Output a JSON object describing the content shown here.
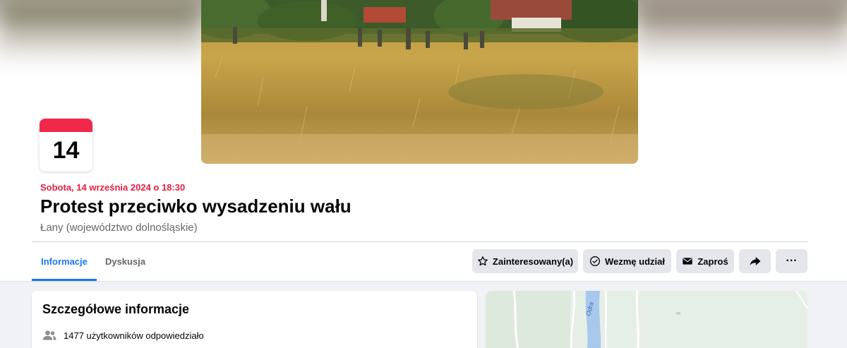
{
  "event": {
    "day_number": "14",
    "date_time": "Sobota, 14 września 2024 o 18:30",
    "title": "Protest przeciwko wysadzeniu wału",
    "location": "Łany (województwo dolnośląskie)"
  },
  "tabs": [
    {
      "label": "Informacje",
      "active": true
    },
    {
      "label": "Dyskusja",
      "active": false
    }
  ],
  "actions": {
    "interested_label": "Zainteresowany(a)",
    "interested_icon": "star-icon",
    "going_label": "Wezmę udział",
    "going_icon": "check-circle-icon",
    "invite_label": "Zaproś",
    "invite_icon": "envelope-icon",
    "share_icon": "share-arrow-icon",
    "more_label": "···"
  },
  "details": {
    "title": "Szczegółowe informacje",
    "responded": "1477 użytkowników odpowiedziało",
    "responded_icon": "people-icon"
  },
  "map": {
    "river_label": "Odra"
  },
  "colors": {
    "accent": "#1877f2",
    "date_red": "#e41e3f",
    "tile_red": "#f02849",
    "button_bg": "#e4e6eb",
    "page_bg": "#f0f2f5"
  }
}
